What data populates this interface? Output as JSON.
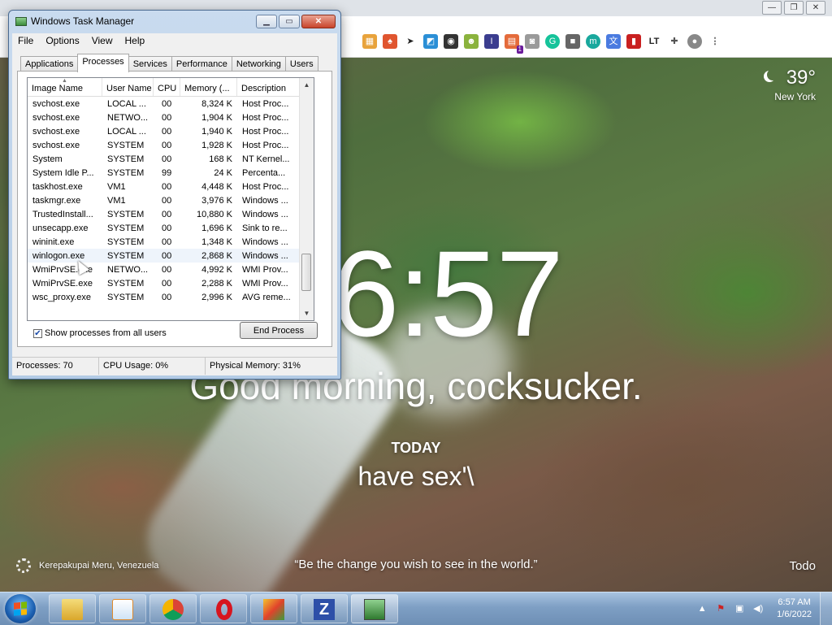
{
  "task_manager": {
    "title": "Windows Task Manager",
    "menu": [
      "File",
      "Options",
      "View",
      "Help"
    ],
    "tabs": [
      "Applications",
      "Processes",
      "Services",
      "Performance",
      "Networking",
      "Users"
    ],
    "active_tab": "Processes",
    "columns": [
      "Image Name",
      "User Name",
      "CPU",
      "Memory (...",
      "Description"
    ],
    "rows": [
      {
        "name": "svchost.exe",
        "user": "LOCAL ...",
        "cpu": "00",
        "mem": "8,324 K",
        "desc": "Host Proc..."
      },
      {
        "name": "svchost.exe",
        "user": "NETWO...",
        "cpu": "00",
        "mem": "1,904 K",
        "desc": "Host Proc..."
      },
      {
        "name": "svchost.exe",
        "user": "LOCAL ...",
        "cpu": "00",
        "mem": "1,940 K",
        "desc": "Host Proc..."
      },
      {
        "name": "svchost.exe",
        "user": "SYSTEM",
        "cpu": "00",
        "mem": "1,928 K",
        "desc": "Host Proc..."
      },
      {
        "name": "System",
        "user": "SYSTEM",
        "cpu": "00",
        "mem": "168 K",
        "desc": "NT Kernel..."
      },
      {
        "name": "System Idle P...",
        "user": "SYSTEM",
        "cpu": "99",
        "mem": "24 K",
        "desc": "Percenta..."
      },
      {
        "name": "taskhost.exe",
        "user": "VM1",
        "cpu": "00",
        "mem": "4,448 K",
        "desc": "Host Proc..."
      },
      {
        "name": "taskmgr.exe",
        "user": "VM1",
        "cpu": "00",
        "mem": "3,976 K",
        "desc": "Windows ..."
      },
      {
        "name": "TrustedInstall...",
        "user": "SYSTEM",
        "cpu": "00",
        "mem": "10,880 K",
        "desc": "Windows ..."
      },
      {
        "name": "unsecapp.exe",
        "user": "SYSTEM",
        "cpu": "00",
        "mem": "1,696 K",
        "desc": "Sink to re..."
      },
      {
        "name": "wininit.exe",
        "user": "SYSTEM",
        "cpu": "00",
        "mem": "1,348 K",
        "desc": "Windows ..."
      },
      {
        "name": "winlogon.exe",
        "user": "SYSTEM",
        "cpu": "00",
        "mem": "2,868 K",
        "desc": "Windows ..."
      },
      {
        "name": "WmiPrvSE.exe",
        "user": "NETWO...",
        "cpu": "00",
        "mem": "4,992 K",
        "desc": "WMI Prov..."
      },
      {
        "name": "WmiPrvSE.exe",
        "user": "SYSTEM",
        "cpu": "00",
        "mem": "2,288 K",
        "desc": "WMI Prov..."
      },
      {
        "name": "wsc_proxy.exe",
        "user": "SYSTEM",
        "cpu": "00",
        "mem": "2,996 K",
        "desc": "AVG reme..."
      }
    ],
    "hovered_row": 11,
    "show_all_label": "Show processes from all users",
    "show_all_checked": true,
    "end_process_label": "End Process",
    "status": {
      "processes": "Processes: 70",
      "cpu": "CPU Usage: 0%",
      "memory": "Physical Memory: 31%"
    }
  },
  "momentum": {
    "temperature": "39°",
    "location": "New York",
    "time": "6:57",
    "greeting": "Good morning, cocksucker.",
    "today_label": "TODAY",
    "focus": "have sex'\\",
    "photo_location": "Kerepakupai Meru, Venezuela",
    "quote": "“Be the change you wish to see in the world.”",
    "todo": "Todo"
  },
  "browser": {
    "extensions": [
      "grid-ext-icon",
      "pin-ext-icon",
      "cursor-ext-icon",
      "window-ext-icon",
      "spy-ext-icon",
      "face-ext-icon",
      "translate-ext-icon",
      "stack-ext-icon",
      "camera-ext-icon",
      "grammarly-ext-icon",
      "square-ext-icon",
      "m-ext-icon",
      "google-translate-ext-icon",
      "red-ext-icon",
      "lt-ext-icon",
      "puzzle-icon",
      "profile-icon",
      "menu-icon"
    ],
    "badge": "1"
  },
  "taskbar": {
    "time": "6:57 AM",
    "date": "1/6/2022",
    "items": [
      "explorer-icon",
      "media-player-icon",
      "chrome-icon",
      "opera-icon",
      "avg-icon",
      "zoner-icon",
      "task-manager-icon"
    ]
  },
  "colors": {
    "title_bar": "#c9dbef",
    "taskbar": "#7e9fc4",
    "selection_hover": "#eef4fb"
  }
}
